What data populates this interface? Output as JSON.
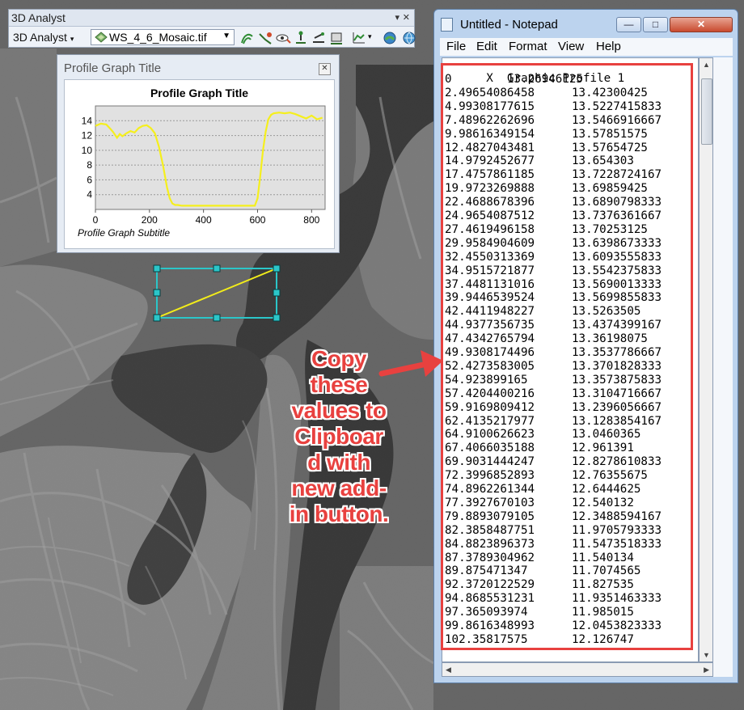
{
  "toolbar": {
    "title": "3D Analyst",
    "label": "3D Analyst",
    "dropdown_value": "WS_4_6_Mosaic.tif",
    "tools": [
      "contour-icon",
      "steepest-path-icon",
      "line-of-sight-icon",
      "interpolate-point-icon",
      "interpolate-line-icon",
      "interpolate-polygon-icon",
      "profile-graph-icon",
      "arcscene-icon",
      "arcglobe-icon"
    ]
  },
  "profile_window": {
    "title": "Profile Graph Title",
    "graph_title": "Profile Graph Title",
    "subtitle": "Profile Graph Subtitle",
    "line_color": "#f5ef1d"
  },
  "chart_data": {
    "type": "line",
    "title": "Profile Graph Title",
    "subtitle": "Profile Graph Subtitle",
    "xlabel": "",
    "ylabel": "",
    "xlim": [
      0,
      850
    ],
    "ylim": [
      2,
      16
    ],
    "xticks": [
      "0",
      "200",
      "400",
      "600",
      "800"
    ],
    "yticks": [
      "4",
      "6",
      "8",
      "10",
      "12",
      "14"
    ],
    "grid": true,
    "series": [
      {
        "x": [
          0,
          20,
          40,
          55,
          65,
          80,
          90,
          100,
          115,
          130,
          145,
          160,
          175,
          190,
          205,
          220,
          235,
          250,
          265,
          275,
          285,
          295,
          305,
          320,
          400,
          500,
          590,
          600,
          610,
          620,
          630,
          640,
          650,
          660,
          680,
          700,
          720,
          740,
          760,
          780,
          800,
          820,
          840
        ],
        "y": [
          13.3,
          13.6,
          13.5,
          12.9,
          12.5,
          11.7,
          12.2,
          11.9,
          12.3,
          12.6,
          12.4,
          13.0,
          13.3,
          13.4,
          13.0,
          12.3,
          10.5,
          8.0,
          5.0,
          3.5,
          2.8,
          2.6,
          2.6,
          2.5,
          2.5,
          2.5,
          2.5,
          3.5,
          6.5,
          10.0,
          12.5,
          14.2,
          14.8,
          15.0,
          15.1,
          15.0,
          15.1,
          14.9,
          14.6,
          14.3,
          14.7,
          14.2,
          14.4
        ]
      }
    ]
  },
  "notepad": {
    "title": "Untitled - Notepad",
    "minimize": "—",
    "maximize": "□",
    "close": "✕",
    "menu": [
      "File",
      "Edit",
      "Format",
      "View",
      "Help"
    ],
    "header": {
      "c1": "X",
      "c2": "Graphic Profile 1"
    },
    "rows": [
      [
        "0",
        "13.26946125"
      ],
      [
        "2.49654086458",
        "13.42300425"
      ],
      [
        "4.99308177615",
        "13.5227415833"
      ],
      [
        "7.48962262696",
        "13.5466916667"
      ],
      [
        "9.98616349154",
        "13.57851575"
      ],
      [
        "12.4827043481",
        "13.57654725"
      ],
      [
        "14.9792452677",
        "13.654303"
      ],
      [
        "17.4757861185",
        "13.7228724167"
      ],
      [
        "19.9723269888",
        "13.69859425"
      ],
      [
        "22.4688678396",
        "13.6890798333"
      ],
      [
        "24.9654087512",
        "13.7376361667"
      ],
      [
        "27.4619496158",
        "13.70253125"
      ],
      [
        "29.9584904609",
        "13.6398673333"
      ],
      [
        "32.4550313369",
        "13.6093555833"
      ],
      [
        "34.9515721877",
        "13.5542375833"
      ],
      [
        "37.4481131016",
        "13.5690013333"
      ],
      [
        "39.9446539524",
        "13.5699855833"
      ],
      [
        "42.4411948227",
        "13.5263505"
      ],
      [
        "44.9377356735",
        "13.4374399167"
      ],
      [
        "47.4342765794",
        "13.36198075"
      ],
      [
        "49.9308174496",
        "13.3537786667"
      ],
      [
        "52.4273583005",
        "13.3701828333"
      ],
      [
        "54.923899165",
        "13.3573875833"
      ],
      [
        "57.4204400216",
        "13.3104716667"
      ],
      [
        "59.9169809412",
        "13.2396056667"
      ],
      [
        "62.4135217977",
        "13.1283854167"
      ],
      [
        "64.9100626623",
        "13.0460365"
      ],
      [
        "67.4066035188",
        "12.961391"
      ],
      [
        "69.9031444247",
        "12.8278610833"
      ],
      [
        "72.3996852893",
        "12.76355675"
      ],
      [
        "74.8962261344",
        "12.6444625"
      ],
      [
        "77.3927670103",
        "12.540132"
      ],
      [
        "79.8893079105",
        "12.3488594167"
      ],
      [
        "82.3858487751",
        "11.9705793333"
      ],
      [
        "84.8823896373",
        "11.5473518333"
      ],
      [
        "87.3789304962",
        "11.540134"
      ],
      [
        "89.875471347",
        "11.7074565"
      ],
      [
        "92.3720122529",
        "11.827535"
      ],
      [
        "94.8685531231",
        "11.9351463333"
      ],
      [
        "97.365093974",
        "11.985015"
      ],
      [
        "99.8616348993",
        "12.0453823333"
      ],
      [
        "102.35817575",
        "12.126747"
      ]
    ]
  },
  "annotation": {
    "lines": [
      "Copy",
      "these",
      "values to",
      "Clipboar",
      "d with",
      "new add-",
      "in button."
    ],
    "color": "#e8413f"
  }
}
